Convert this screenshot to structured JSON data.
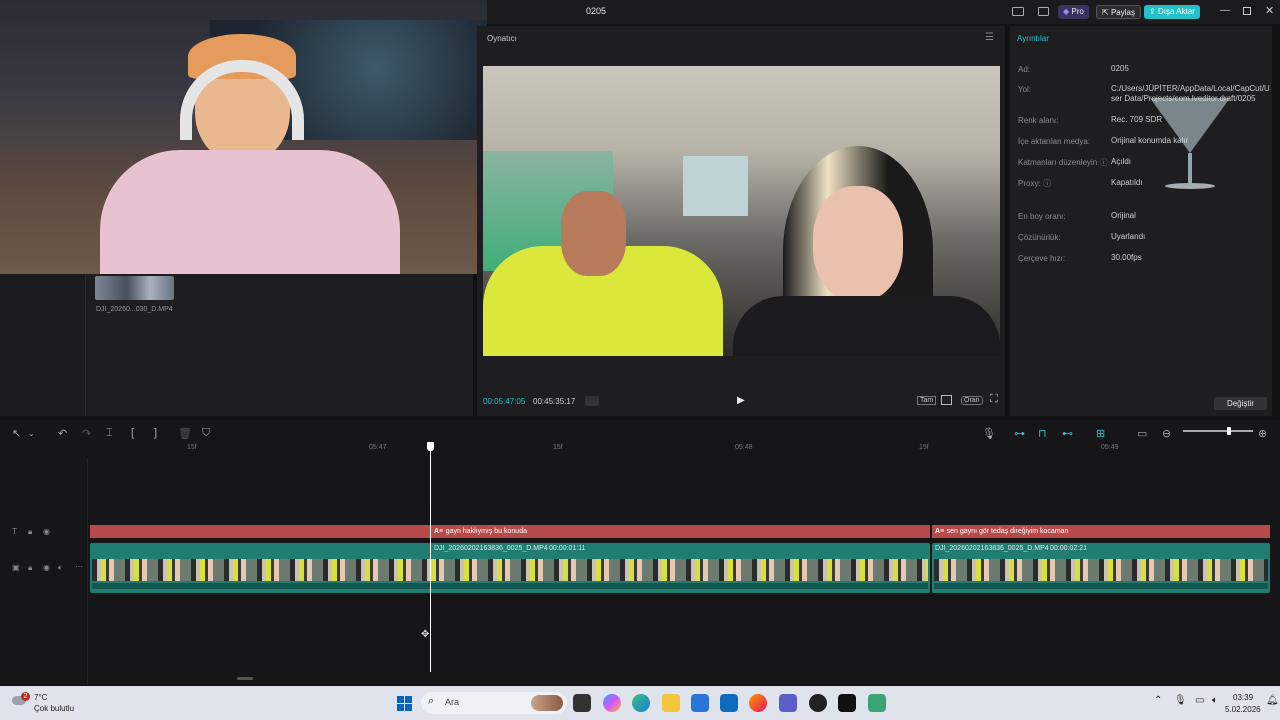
{
  "window": {
    "title": "0205",
    "pro_label": "Pro",
    "share_label": "Paylaş",
    "export_label": "Dışa Aktar"
  },
  "media": {
    "clip_name": "DJI_20260...030_D.MP4"
  },
  "player": {
    "title": "Oynatıcı",
    "current_time": "00:05:47:05",
    "total_time": "00:45:35:17",
    "full_label": "Tam",
    "ratio_label": "Oran"
  },
  "details": {
    "title": "Ayrıntılar",
    "rows": [
      {
        "label": "Ad:",
        "value": "0205"
      },
      {
        "label": "Yol:",
        "value": "C:/Users/JÜPİTER/AppData/Local/CapCut/User Data/Projects/com.lveditor.draft/0205"
      },
      {
        "label": "Renk alanı:",
        "value": "Rec. 709 SDR"
      },
      {
        "label": "İçe aktarılan medya:",
        "value": "Orijinal konumda kalır"
      },
      {
        "label": "Katmanları düzenleyin",
        "value": "Açıldı"
      },
      {
        "label": "Proxy:",
        "value": "Kapatıldı"
      },
      {
        "label": "En boy oranı:",
        "value": "Orijinal"
      },
      {
        "label": "Çözünürlük:",
        "value": "Uyarlandı"
      },
      {
        "label": "Çerçeve hızı:",
        "value": "30.00fps"
      }
    ],
    "change_label": "Değiştir"
  },
  "timeline": {
    "ruler": [
      "15f",
      "05:47",
      "15f",
      "05:48",
      "15f",
      "05:49"
    ],
    "text_clips": [
      "gayn haklıymış bu konuda",
      "sen gaynı gör tedaş direğiyim kocaman"
    ],
    "video_clips": [
      {
        "name": "DJI_20260202163836_0025_D.MP4",
        "duration": "00:00:01:11"
      },
      {
        "name": "DJI_20260202163836_0025_D.MP4",
        "duration": "00:00:02:21"
      }
    ],
    "text_tag": "A≡"
  },
  "taskbar": {
    "weather_temp": "7°C",
    "weather_desc": "Çok bulutlu",
    "weather_badge": "2",
    "search_placeholder": "Ara",
    "time": "03:39",
    "date": "5.02.2026"
  },
  "colors": {
    "accent": "#25c2c8",
    "text_track": "#b84a4a",
    "video_track": "#1f7d72",
    "playhead": "#ffffff"
  }
}
